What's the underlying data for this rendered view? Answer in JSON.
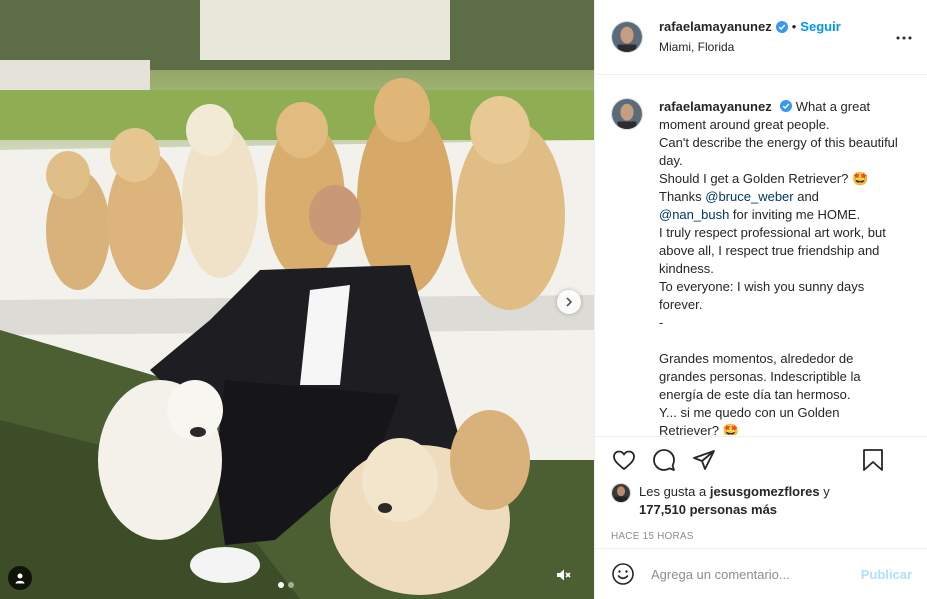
{
  "post": {
    "username": "rafaelamayanunez",
    "follow_separator": "•",
    "follow_label": "Seguir",
    "location": "Miami, Florida"
  },
  "caption": {
    "username": "rafaelamayanunez",
    "line1": "What a great moment around great people.\nCan't describe the energy of this beautiful day.\nShould I get a Golden Retriever? 🤩\nThanks ",
    "mention1": "@bruce_weber",
    "line2": " and\n",
    "mention2": "@nan_bush",
    "line3": " for inviting me HOME.\nI truly respect professional art work, but above all, I respect true friendship and kindness.\nTo everyone: I wish you sunny days forever.\n-\n\nGrandes momentos, alrededor de grandes personas. Indescriptible la energía de este día tan hermoso.\nY... si me quedo con un Golden Retriever? 🤩"
  },
  "likes": {
    "prefix": "Les gusta a ",
    "liker": "jesusgomezflores",
    "middle": " y",
    "count": "177,510 personas más"
  },
  "timestamp": "HACE 15 HORAS",
  "comment_box": {
    "placeholder": "Agrega un comentario...",
    "publish_label": "Publicar"
  },
  "carousel": {
    "total_slides": 2,
    "active_slide": 1
  },
  "icons": {
    "verified": "verified-badge-icon",
    "more": "more-options-icon",
    "like": "heart-icon",
    "comment": "comment-bubble-icon",
    "share": "paper-plane-icon",
    "save": "bookmark-icon",
    "emoji": "smiley-icon",
    "next": "chevron-right-icon",
    "tags": "user-tag-icon",
    "mute": "speaker-muted-icon"
  },
  "colors": {
    "accent": "#0095f6",
    "publish_disabled": "#b2dffc",
    "mention": "#00376b",
    "verified": "#3897f0"
  }
}
